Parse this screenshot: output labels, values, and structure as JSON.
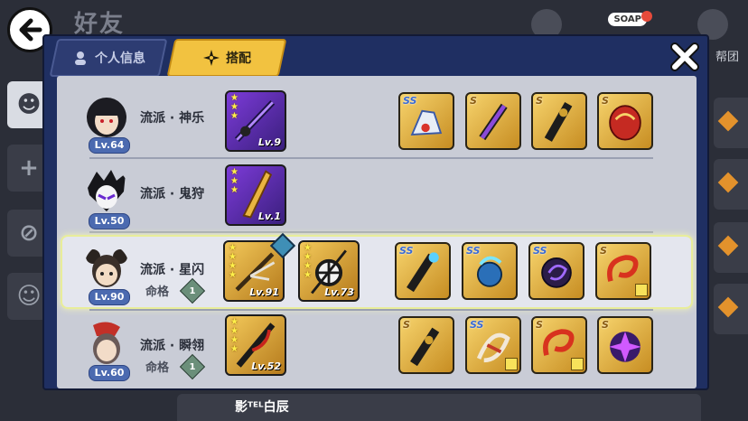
{
  "background": {
    "title": "好友",
    "guild_label": "帮团",
    "soap_badge": "SOAP",
    "bottom_name": "影ᵀᴱᴸ白辰"
  },
  "tabs": [
    {
      "label": "个人信息",
      "active": false
    },
    {
      "label": "搭配",
      "active": true
    }
  ],
  "rows": [
    {
      "level": "Lv.64",
      "school": "流派 · 神乐",
      "fate_label": "",
      "fate_value": "",
      "selected": false,
      "weapons": [
        {
          "color": "purple",
          "stars": 3,
          "level": "Lv.9"
        }
      ],
      "items": [
        {
          "grade": "SS"
        },
        {
          "grade": "S"
        },
        {
          "grade": "S"
        },
        {
          "grade": "S"
        }
      ]
    },
    {
      "level": "Lv.50",
      "school": "流派 · 鬼狩",
      "fate_label": "",
      "fate_value": "",
      "selected": false,
      "weapons": [
        {
          "color": "purple",
          "stars": 3,
          "level": "Lv.1"
        }
      ],
      "items": []
    },
    {
      "level": "Lv.90",
      "school": "流派 · 星闪",
      "fate_label": "命格",
      "fate_value": "1",
      "selected": true,
      "weapons": [
        {
          "color": "gold",
          "stars": 4,
          "level": "Lv.91"
        },
        {
          "color": "gold",
          "stars": 4,
          "level": "Lv.73"
        }
      ],
      "items": [
        {
          "grade": "SS"
        },
        {
          "grade": "SS"
        },
        {
          "grade": "SS"
        },
        {
          "grade": "S"
        }
      ]
    },
    {
      "level": "Lv.60",
      "school": "流派 · 瞬翎",
      "fate_label": "命格",
      "fate_value": "1",
      "selected": false,
      "weapons": [
        {
          "color": "gold",
          "stars": 4,
          "level": "Lv.52"
        }
      ],
      "items": [
        {
          "grade": "S"
        },
        {
          "grade": "SS"
        },
        {
          "grade": "S"
        },
        {
          "grade": "S"
        }
      ]
    }
  ]
}
